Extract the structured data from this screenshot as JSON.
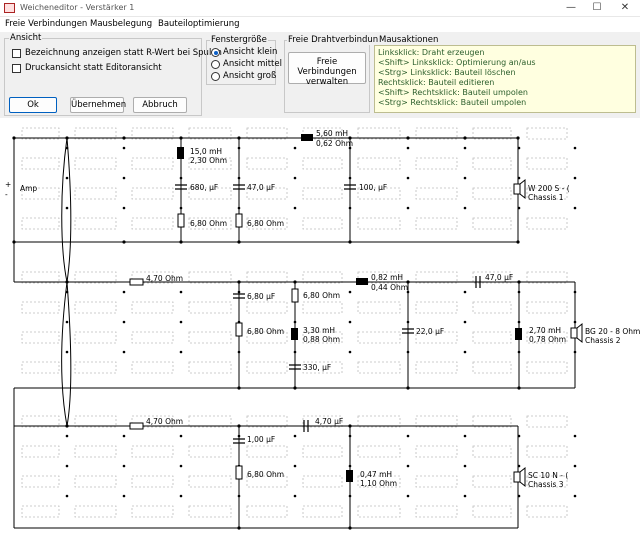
{
  "window": {
    "title": "Weicheneditor - Verstärker 1",
    "controls": [
      "—",
      "☐",
      "✕"
    ]
  },
  "menu": {
    "items": [
      "Freie Verbindungen",
      "Mausbelegung",
      "Bauteiloptimierung"
    ]
  },
  "ansicht": {
    "title": "Ansicht",
    "option1": "Bezeichnung anzeigen statt R-Wert bei Spulen",
    "option2": "Druckansicht statt Editoransicht"
  },
  "buttons": {
    "ok": "Ok",
    "apply": "Übernehmen",
    "cancel": "Abbruch"
  },
  "fenstergroesse": {
    "title": "Fenstergröße",
    "options": [
      "Ansicht klein",
      "Ansicht mittel",
      "Ansicht groß"
    ],
    "selected": "Ansicht klein"
  },
  "freie": {
    "title": "Freie Drahtverbindungen",
    "button_line1": "Freie Verbindungen",
    "button_line2": "verwalten"
  },
  "maus": {
    "title": "Mausaktionen",
    "lines": [
      "Linksklick: Draht erzeugen",
      "<Shift> Linksklick: Optimierung an/aus",
      "<Strg> Linksklick: Bauteil löschen",
      "Rechtsklick: Bauteil editieren",
      "<Shift> Rechtsklick: Bauteil umpolen",
      "<Strg> Rechtsklick: Bauteil umpolen"
    ]
  },
  "circuit": {
    "amp_label": "Amp",
    "amp_plus": "+",
    "amp_minus": "-",
    "section1": {
      "l1": [
        "15,0 mH",
        "2,30 Ohm"
      ],
      "l2": [
        "5,60 mH",
        "0,62 Ohm"
      ],
      "c1": "680, µF",
      "c2": "47,0 µF",
      "c3": "100, µF",
      "r1": "6,80 Ohm",
      "r2": "6,80 Ohm",
      "driver": [
        "W 200 S - (",
        "Chassis 1"
      ]
    },
    "section2": {
      "r_series": "4,70 Ohm",
      "l1": [
        "0,82 mH",
        "0,44 Ohm"
      ],
      "c_series": "47,0 µF",
      "c1": "6,80 µF",
      "r1": "6,80 Ohm",
      "r2": "6,80 Ohm",
      "l2": [
        "3,30 mH",
        "0,88 Ohm"
      ],
      "c2": "330, µF",
      "c3": "22,0 µF",
      "l3": [
        "2,70 mH",
        "0,78 Ohm"
      ],
      "driver": [
        "BG 20 - 8 Ohm",
        "Chassis 2"
      ]
    },
    "section3": {
      "r_series": "4,70 Ohm",
      "c_series": "4,70 µF",
      "c1": "1,00 µF",
      "r1": "6,80 Ohm",
      "l1": [
        "0,47 mH",
        "1,10 Ohm"
      ],
      "driver": [
        "SC 10 N - (",
        "Chassis 3"
      ]
    }
  }
}
